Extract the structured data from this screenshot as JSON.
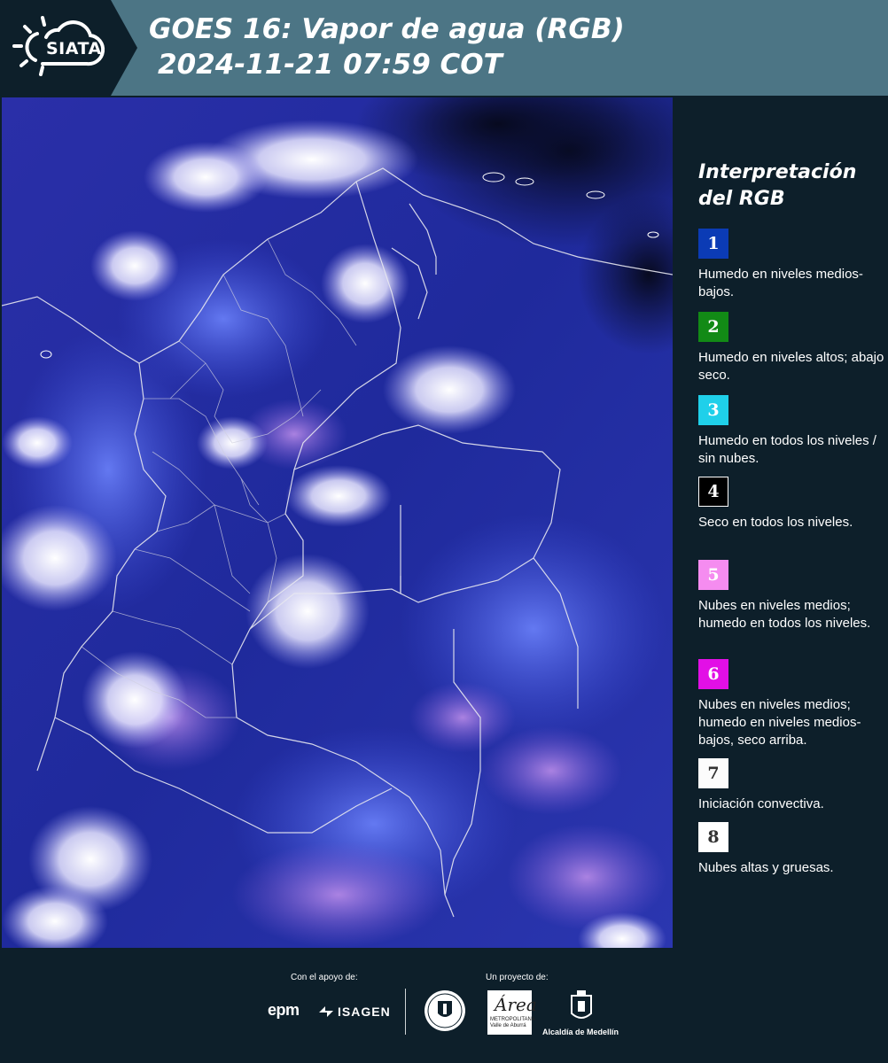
{
  "header": {
    "logo_text": "SIATA",
    "title": "GOES 16: Vapor de agua (RGB)",
    "subtitle": "2024-11-21 07:59 COT"
  },
  "map": {
    "image_icon": "satellite-water-vapor-rgb-image",
    "background_color": "#1c2c9a"
  },
  "legend": {
    "title_line1": "Interpretación",
    "title_line2": "del RGB",
    "items": [
      {
        "number": "1",
        "color": "#0b3bb5",
        "text_color": "#ffffff",
        "label": "Humedo en niveles medios-bajos."
      },
      {
        "number": "2",
        "color": "#128a16",
        "text_color": "#ffffff",
        "label": "Humedo en niveles altos; abajo seco."
      },
      {
        "number": "3",
        "color": "#1fd0ea",
        "text_color": "#ffffff",
        "label": "Humedo en todos los niveles / sin nubes."
      },
      {
        "number": "4",
        "color": "#000000",
        "text_color": "#ffffff",
        "label": "Seco en todos los niveles."
      },
      {
        "number": "5",
        "color": "#f58cf0",
        "text_color": "#ffffff",
        "label": "Nubes en niveles medios; humedo en todos los niveles."
      },
      {
        "number": "6",
        "color": "#e20fe6",
        "text_color": "#ffffff",
        "label": "Nubes en niveles medios; humedo en niveles medios-bajos, seco arriba."
      },
      {
        "number": "7",
        "color": "#fcfcfc",
        "text_color": "#333333",
        "label": "Iniciación convectiva."
      },
      {
        "number": "8",
        "color": "#ffffff",
        "text_color": "#333333",
        "label": "Nubes altas y gruesas."
      }
    ]
  },
  "footer": {
    "support_label": "Con el apoyo de:",
    "project_label": "Un proyecto de:",
    "sponsor1": "epm",
    "sponsor2": "ISAGEN",
    "area_script": "Área",
    "area_caption": "METROPOLITANA Valle de Aburrá",
    "medellin_label": "Alcaldía de Medellín"
  }
}
